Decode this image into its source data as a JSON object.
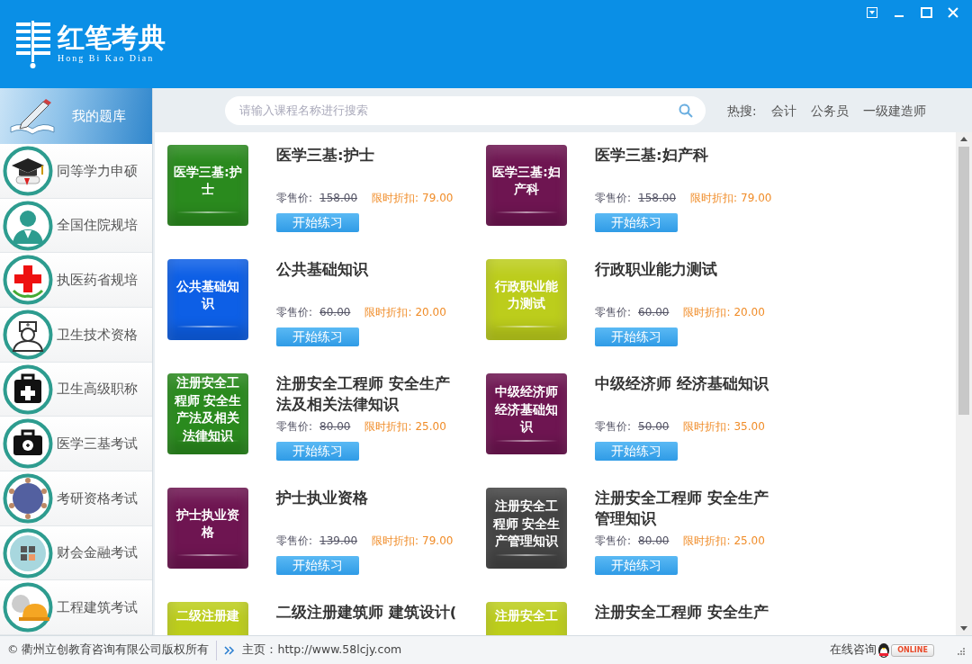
{
  "app": {
    "logo_name": "红笔考典",
    "logo_pinyin": "Hong Bi Kao Dian"
  },
  "sidebar": {
    "header": "我的题库",
    "items": [
      {
        "label": "同等学力申硕"
      },
      {
        "label": "全国住院规培"
      },
      {
        "label": "执医药省规培"
      },
      {
        "label": "卫生技术资格"
      },
      {
        "label": "卫生高级职称"
      },
      {
        "label": "医学三基考试"
      },
      {
        "label": "考研资格考试"
      },
      {
        "label": "财会金融考试"
      },
      {
        "label": "工程建筑考试"
      }
    ]
  },
  "search": {
    "placeholder": "请输入课程名称进行搜索",
    "hot_label": "热搜:",
    "hot_terms": [
      "会计",
      "公务员",
      "一级建造师"
    ]
  },
  "courses": [
    {
      "kind": "full",
      "tile_text": "医学三基:护士",
      "color": "#2a8a1e",
      "title": "医学三基:护士",
      "retail_label": "零售价:",
      "retail_price": "158.00",
      "discount_label": "限时折扣:",
      "discount_price": "79.00",
      "button": "开始练习"
    },
    {
      "kind": "full",
      "tile_text": "医学三基:妇产科",
      "color": "#6e1551",
      "title": "医学三基:妇产科",
      "retail_label": "零售价:",
      "retail_price": "158.00",
      "discount_label": "限时折扣:",
      "discount_price": "79.00",
      "button": "开始练习"
    },
    {
      "kind": "full",
      "tile_text": "公共基础知识",
      "color": "#0d5fe6",
      "title": "公共基础知识",
      "retail_label": "零售价:",
      "retail_price": "60.00",
      "discount_label": "限时折扣:",
      "discount_price": "20.00",
      "button": "开始练习"
    },
    {
      "kind": "full",
      "tile_text": "行政职业能力测试",
      "color": "#bccd1c",
      "title": "行政职业能力测试",
      "retail_label": "零售价:",
      "retail_price": "60.00",
      "discount_label": "限时折扣:",
      "discount_price": "20.00",
      "button": "开始练习"
    },
    {
      "kind": "full",
      "tile_text": "注册安全工程师 安全生产法及相关法律知识",
      "color": "#2a8a1e",
      "title": "注册安全工程师 安全生产法及相关法律知识",
      "retail_label": "零售价:",
      "retail_price": "80.00",
      "discount_label": "限时折扣:",
      "discount_price": "25.00",
      "button": "开始练习"
    },
    {
      "kind": "full",
      "tile_text": "中级经济师经济基础知识",
      "color": "#6e1551",
      "title": "中级经济师 经济基础知识",
      "retail_label": "零售价:",
      "retail_price": "50.00",
      "discount_label": "限时折扣:",
      "discount_price": "35.00",
      "button": "开始练习"
    },
    {
      "kind": "full",
      "tile_text": "护士执业资格",
      "color": "#6e1551",
      "title": "护士执业资格",
      "retail_label": "零售价:",
      "retail_price": "139.00",
      "discount_label": "限时折扣:",
      "discount_price": "79.00",
      "button": "开始练习"
    },
    {
      "kind": "full",
      "tile_text": "注册安全工程师 安全生产管理知识",
      "color": "#444444",
      "title": "注册安全工程师 安全生产管理知识",
      "retail_label": "零售价:",
      "retail_price": "80.00",
      "discount_label": "限时折扣:",
      "discount_price": "25.00",
      "button": "开始练习"
    },
    {
      "kind": "cut",
      "tile_text": "二级注册建",
      "color": "#bccd1c",
      "title": "二级注册建筑师  建筑设计("
    },
    {
      "kind": "cut",
      "tile_text": "注册安全工",
      "color": "#bccd1c",
      "title": "注册安全工程师 安全生产"
    }
  ],
  "footer": {
    "copyright": "© 衢州立创教育咨询有限公司版权所有",
    "homepage": "主页：http://www.58lcjy.com",
    "consult": "在线咨询",
    "online_badge": "ONLINE"
  }
}
